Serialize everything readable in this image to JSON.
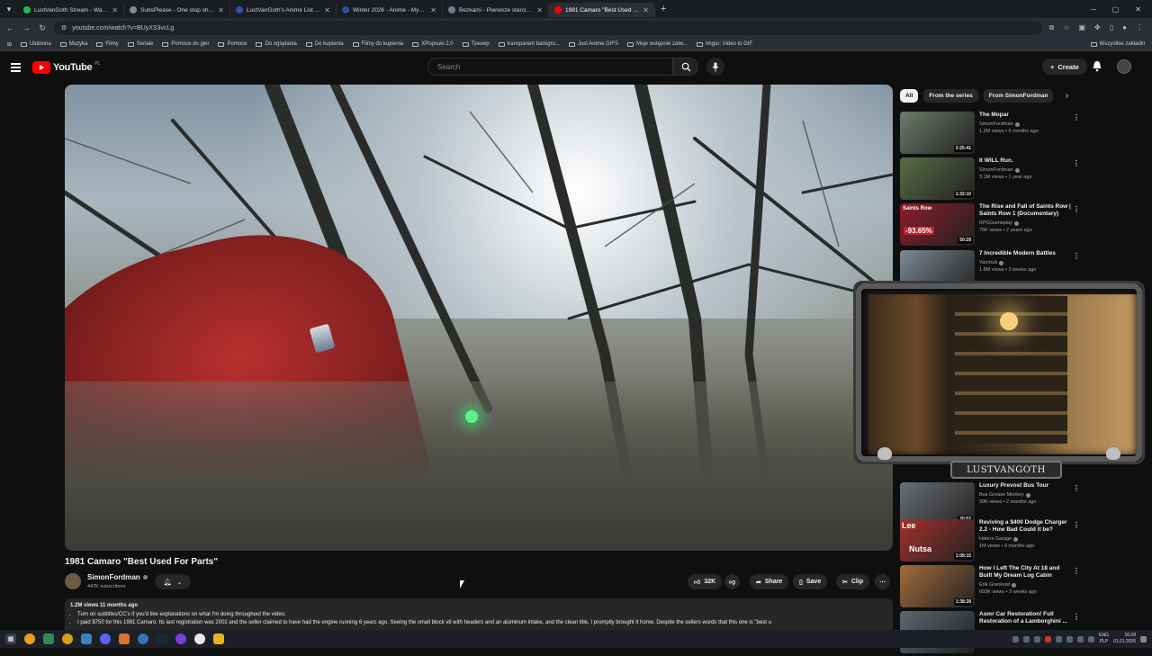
{
  "browser": {
    "tabs": [
      {
        "title": "LustVanGoth Stream - Watch L",
        "color": "#1db954"
      },
      {
        "title": "SubsPlease - One stop shop fo",
        "color": "#8a8a8a"
      },
      {
        "title": "LustVanGoth's Anime List - My",
        "color": "#2e51a2"
      },
      {
        "title": "Winter 2026 - Anime - MyAnim",
        "color": "#2e51a2"
      },
      {
        "title": "Bezkami - Pierwsze starcie / Th",
        "color": "#6a7d8d"
      },
      {
        "title": "1981 Camaro \"Best Used Fo",
        "color": "#ff0000",
        "active": true
      }
    ],
    "url": "youtube.com/watch?v=BUyXS3vcLg",
    "bookmarks": [
      "Ulubiona",
      "Muzyka",
      "Filmy",
      "Seriale",
      "Pomoce do gier",
      "Pomoce",
      "Do oglądania",
      "Do kupienia",
      "Filmy do kupienia",
      "XPopsuki 2.0",
      "Tpexep",
      "transparent backgro...",
      "Just Anime GIFS",
      "Moje wstępnie zatw...",
      "Imgur: Video to GIF"
    ],
    "bookmarks_right": "Wszystkie zakładki"
  },
  "youtube": {
    "logo": "YouTube",
    "logo_region": "PL",
    "search_placeholder": "Search",
    "create_label": "Create"
  },
  "video": {
    "title": "1981 Camaro \"Best Used For Parts\"",
    "channel": "SimonFordman",
    "subscribers": "447K subscribers",
    "likes": "32K",
    "share_label": "Share",
    "save_label": "Save",
    "clip_label": "Clip",
    "stats": "1.2M views  11 months ago",
    "desc_line1": "Turn on subtitles/CC's if you'd like explanations on what I'm doing throughout the video.",
    "desc_line2": "I paid $750 for this 1981 Camaro. Its last registration was 2002 and the seller claimed to have had the engine running 6 years ago. Seeing the small block v8 with headers and an aluminum intake, and the clean title, I promptly brought it home. Despite the sellers words that this one is \"best u"
  },
  "chips": [
    "All",
    "From the series",
    "From SimonFordman"
  ],
  "recommendations": [
    {
      "title": "The Mopar",
      "channel": "SimonFordman",
      "views": "1.2M views • 6 months ago",
      "duration": "2:25:41",
      "thumb": "#6d7a6a"
    },
    {
      "title": "It WILL Run.",
      "channel": "SimonFordman",
      "views": "3.1M views • 1 year ago",
      "duration": "1:32:10",
      "thumb": "#5a6b45"
    },
    {
      "title": "The Rise and Fall of Saints Row | Saints Row 1 (Documentary)",
      "channel": "RPGGameplay",
      "views": "75K views • 2 years ago",
      "duration": "50:28",
      "thumb": "#8b1c2a"
    },
    {
      "title": "7 Incredible Modern Battles",
      "channel": "Yarnhub",
      "views": "1.8M views • 3 weeks ago",
      "duration": "",
      "thumb": "#7e8a93"
    },
    {
      "title": "Luxury Prevost Bus Tour",
      "channel": "Bus Grease Monkey",
      "views": "39K views • 2 months ago",
      "duration": "20:52",
      "thumb": "#6b6f74"
    },
    {
      "title": "Reviving a $400 Dodge Charger 2.2 - How Bad Could it be?",
      "channel": "Haters Garage",
      "views": "1M views • 9 months ago",
      "duration": "1:09:15",
      "thumb": "#a3302b"
    },
    {
      "title": "How I Left The City At 18 and Built My Dream Log Cabin",
      "channel": "Erik Grankvist",
      "views": "603K views • 3 weeks ago",
      "duration": "1:38:28",
      "thumb": "#a36c3a"
    },
    {
      "title": "Asmr Car Restoration! Full Restoration of a Lamborghini ...",
      "channel": "",
      "views": "",
      "duration": "",
      "thumb": "#5d6670"
    }
  ],
  "thumb_overlays": {
    "saints_row": "Saints Row",
    "stock": "-93.65%",
    "lee": "Lee",
    "nutsa": "Nutsa"
  },
  "overlay_name": "LUSTVANGOTH",
  "tray": {
    "lang1": "ENG",
    "lang2": "PLP",
    "time": "16:08",
    "date": "01.01.2026"
  }
}
